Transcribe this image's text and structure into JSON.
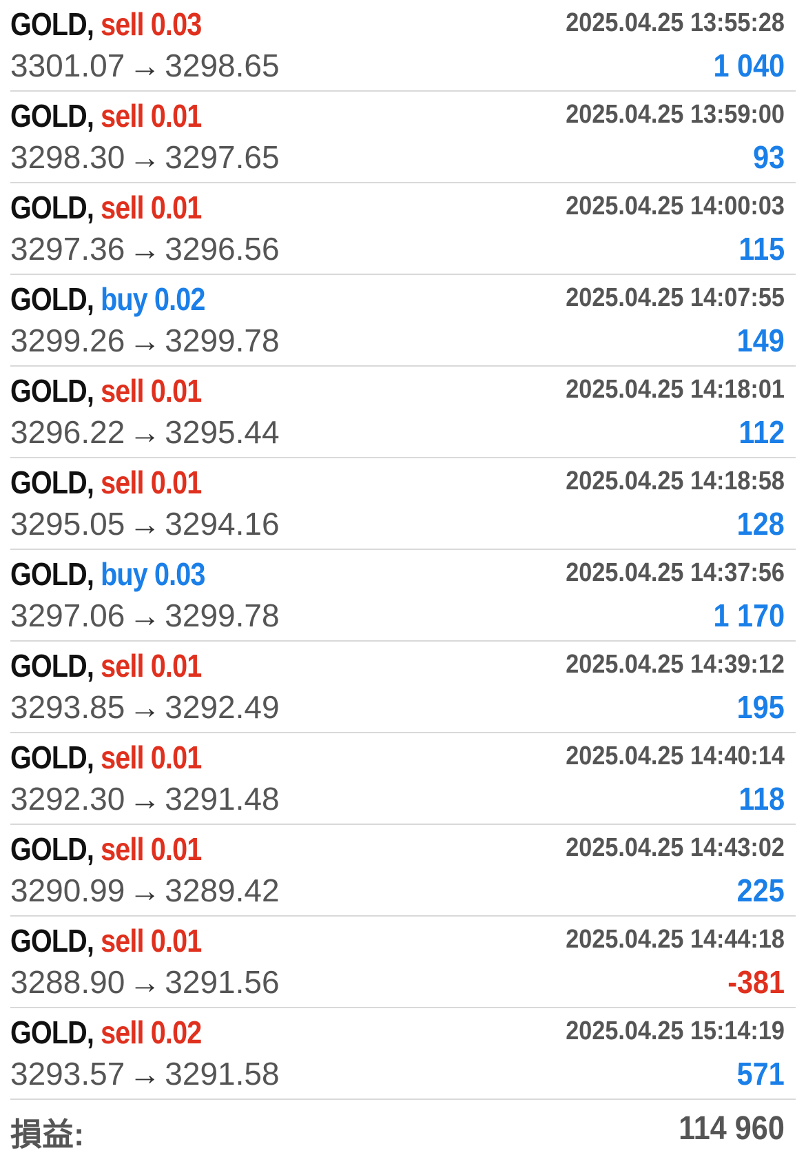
{
  "trades": [
    {
      "symbol": "GOLD,",
      "side": "sell",
      "volume": "0.03",
      "time": "2025.04.25 13:55:28",
      "open": "3301.07",
      "arrow": "→",
      "close": "3298.65",
      "profit": "1 040",
      "profit_sign": "pos"
    },
    {
      "symbol": "GOLD,",
      "side": "sell",
      "volume": "0.01",
      "time": "2025.04.25 13:59:00",
      "open": "3298.30",
      "arrow": "→",
      "close": "3297.65",
      "profit": "93",
      "profit_sign": "pos"
    },
    {
      "symbol": "GOLD,",
      "side": "sell",
      "volume": "0.01",
      "time": "2025.04.25 14:00:03",
      "open": "3297.36",
      "arrow": "→",
      "close": "3296.56",
      "profit": "115",
      "profit_sign": "pos"
    },
    {
      "symbol": "GOLD,",
      "side": "buy",
      "volume": "0.02",
      "time": "2025.04.25 14:07:55",
      "open": "3299.26",
      "arrow": "→",
      "close": "3299.78",
      "profit": "149",
      "profit_sign": "pos"
    },
    {
      "symbol": "GOLD,",
      "side": "sell",
      "volume": "0.01",
      "time": "2025.04.25 14:18:01",
      "open": "3296.22",
      "arrow": "→",
      "close": "3295.44",
      "profit": "112",
      "profit_sign": "pos"
    },
    {
      "symbol": "GOLD,",
      "side": "sell",
      "volume": "0.01",
      "time": "2025.04.25 14:18:58",
      "open": "3295.05",
      "arrow": "→",
      "close": "3294.16",
      "profit": "128",
      "profit_sign": "pos"
    },
    {
      "symbol": "GOLD,",
      "side": "buy",
      "volume": "0.03",
      "time": "2025.04.25 14:37:56",
      "open": "3297.06",
      "arrow": "→",
      "close": "3299.78",
      "profit": "1 170",
      "profit_sign": "pos"
    },
    {
      "symbol": "GOLD,",
      "side": "sell",
      "volume": "0.01",
      "time": "2025.04.25 14:39:12",
      "open": "3293.85",
      "arrow": "→",
      "close": "3292.49",
      "profit": "195",
      "profit_sign": "pos"
    },
    {
      "symbol": "GOLD,",
      "side": "sell",
      "volume": "0.01",
      "time": "2025.04.25 14:40:14",
      "open": "3292.30",
      "arrow": "→",
      "close": "3291.48",
      "profit": "118",
      "profit_sign": "pos"
    },
    {
      "symbol": "GOLD,",
      "side": "sell",
      "volume": "0.01",
      "time": "2025.04.25 14:43:02",
      "open": "3290.99",
      "arrow": "→",
      "close": "3289.42",
      "profit": "225",
      "profit_sign": "pos"
    },
    {
      "symbol": "GOLD,",
      "side": "sell",
      "volume": "0.01",
      "time": "2025.04.25 14:44:18",
      "open": "3288.90",
      "arrow": "→",
      "close": "3291.56",
      "profit": "-381",
      "profit_sign": "neg"
    },
    {
      "symbol": "GOLD,",
      "side": "sell",
      "volume": "0.02",
      "time": "2025.04.25 15:14:19",
      "open": "3293.57",
      "arrow": "→",
      "close": "3291.58",
      "profit": "571",
      "profit_sign": "pos"
    }
  ],
  "summary": {
    "label": "損益:",
    "value": "114 960"
  },
  "colors": {
    "sell": "#e0301e",
    "buy": "#1a7fe8",
    "profit_positive": "#1a7fe8",
    "profit_negative": "#e0301e",
    "text_secondary": "#555555",
    "divider": "#d9d9d9"
  }
}
